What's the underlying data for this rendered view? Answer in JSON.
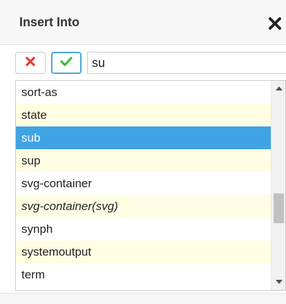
{
  "dialog": {
    "title": "Insert Into",
    "close_icon": "close-icon",
    "colors": {
      "header_bg": "#f7f7f7",
      "selected_bg": "#3fa3e4",
      "alt_row_bg": "#fffde3",
      "cancel_icon": "#e03a3a",
      "confirm_icon": "#3fbf3f",
      "confirm_border": "#4aa3df"
    }
  },
  "toolbar": {
    "cancel_icon": "x-icon",
    "confirm_icon": "checkmark-icon",
    "search_value": "su"
  },
  "list": {
    "items": [
      {
        "label": "sort-as"
      },
      {
        "label": "state"
      },
      {
        "label": "sub"
      },
      {
        "label": "sup"
      },
      {
        "label": "svg-container"
      },
      {
        "label": "svg-container(svg)"
      },
      {
        "label": "synph"
      },
      {
        "label": "systemoutput"
      },
      {
        "label": "term"
      }
    ],
    "selected_index": 2
  }
}
